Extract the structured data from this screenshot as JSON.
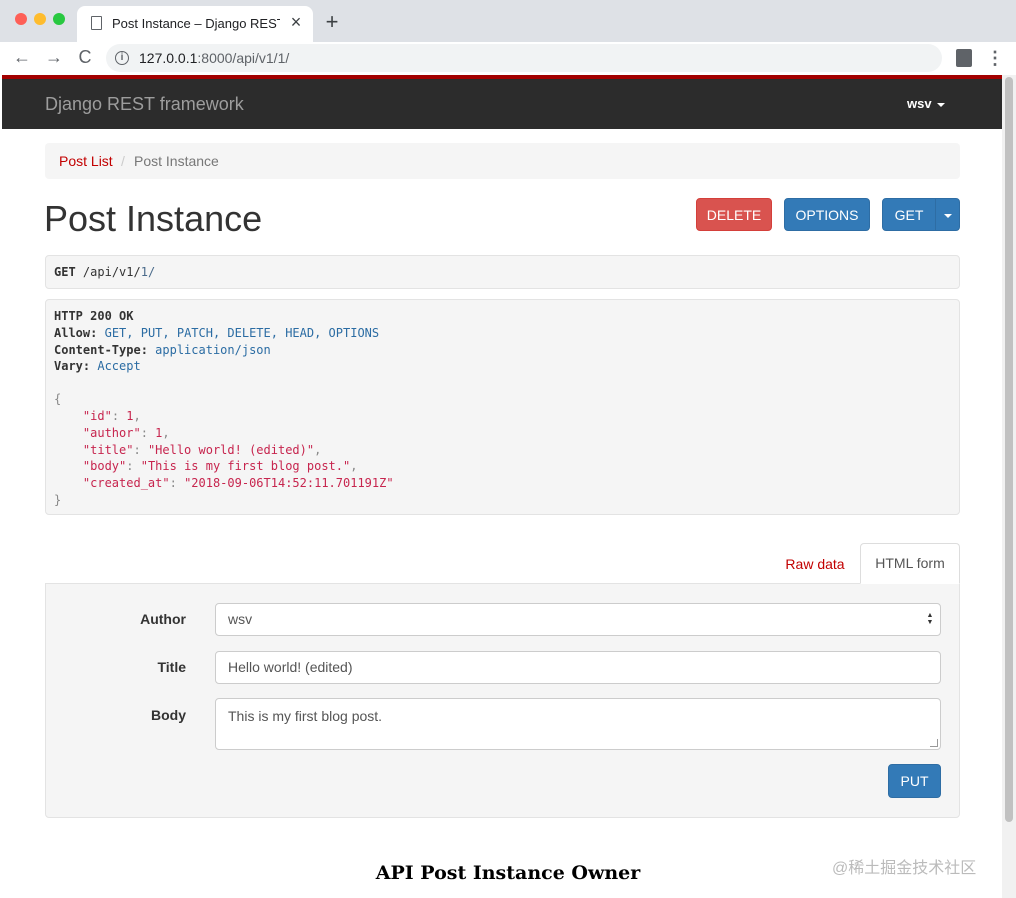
{
  "browser": {
    "tab_title": "Post Instance – Django REST f",
    "tab_close": "×",
    "new_tab": "+",
    "url_host": "127.0.0.1",
    "url_rest": ":8000/api/v1/1/",
    "back": "←",
    "forward": "→",
    "reload": "C",
    "info_icon_glyph": "i",
    "menu_glyph": "⋮"
  },
  "navbar": {
    "brand": "Django REST framework",
    "user": "wsv"
  },
  "breadcrumb": {
    "link": "Post List",
    "separator": "/",
    "current": "Post Instance"
  },
  "page": {
    "title": "Post Instance"
  },
  "actions": {
    "delete": "DELETE",
    "options": "OPTIONS",
    "get": "GET"
  },
  "request": {
    "method": "GET",
    "path_prefix": "/api/v1/",
    "path_id": "1",
    "path_suffix": "/"
  },
  "response": {
    "status": "HTTP 200 OK",
    "headers": [
      {
        "key": "Allow:",
        "value": "GET, PUT, PATCH, DELETE, HEAD, OPTIONS"
      },
      {
        "key": "Content-Type:",
        "value": "application/json"
      },
      {
        "key": "Vary:",
        "value": "Accept"
      }
    ],
    "open_brace": "{",
    "close_brace": "}",
    "fields": [
      {
        "key": "\"id\"",
        "value": "1",
        "sep": ","
      },
      {
        "key": "\"author\"",
        "value": "1",
        "sep": ","
      },
      {
        "key": "\"title\"",
        "value": "\"Hello world! (edited)\"",
        "sep": ","
      },
      {
        "key": "\"body\"",
        "value": "\"This is my first blog post.\"",
        "sep": ","
      },
      {
        "key": "\"created_at\"",
        "value": "\"2018-09-06T14:52:11.701191Z\"",
        "sep": ""
      }
    ]
  },
  "form_tabs": {
    "raw": "Raw data",
    "html": "HTML form"
  },
  "form": {
    "author_label": "Author",
    "author_value": "wsv",
    "title_label": "Title",
    "title_value": "Hello world! (edited)",
    "body_label": "Body",
    "body_value": "This is my first blog post.",
    "submit": "PUT"
  },
  "caption": "API Post Instance Owner",
  "watermark": "@稀土掘金技术社区",
  "colors": {
    "brand_red": "#a30000",
    "navbar_bg": "#2c2c2c",
    "danger": "#d9534f",
    "primary": "#337ab7",
    "link": "#c20000"
  }
}
